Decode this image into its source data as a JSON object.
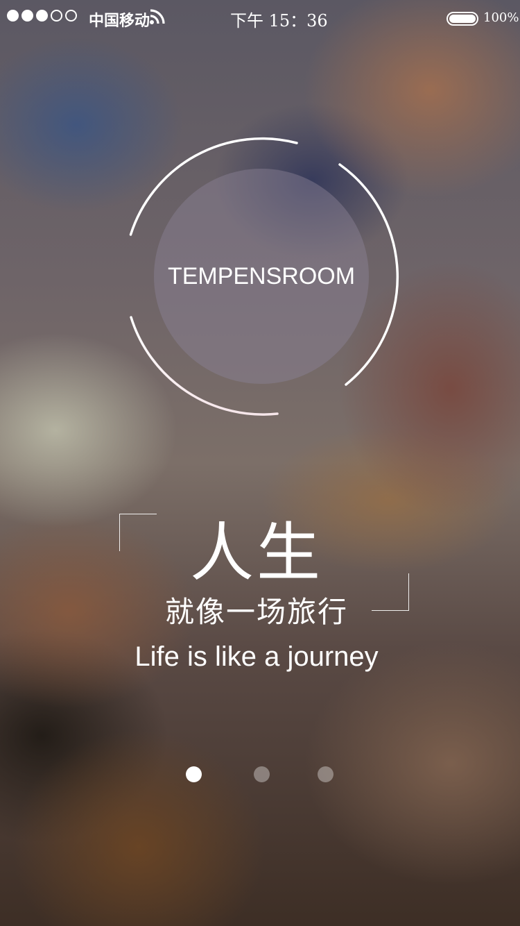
{
  "status_bar": {
    "signal_dots": [
      true,
      true,
      true,
      false,
      false
    ],
    "carrier": "中国移动",
    "time": "下午 15：36",
    "battery_percent": "100%",
    "battery_level": 1.0
  },
  "logo": {
    "text": "TEMPENSROOM"
  },
  "slogan": {
    "headline": "人生",
    "subline": "就像一场旅行",
    "tagline": "Life is like a journey"
  },
  "pager": {
    "page_count": 3,
    "active_index": 0
  },
  "colors": {
    "text": "#ffffff",
    "ring": "#ffffff",
    "dot_active": "#ffffff",
    "dot_inactive": "rgba(255,255,255,0.35)"
  },
  "icons": {
    "wifi": "wifi-icon",
    "battery": "battery-icon"
  }
}
